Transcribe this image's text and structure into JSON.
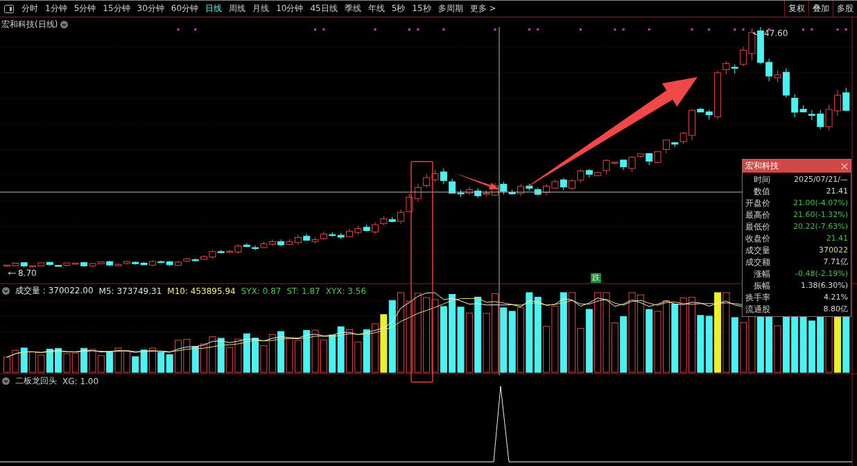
{
  "toolbar": {
    "periods": [
      {
        "label": "分时",
        "selected": false
      },
      {
        "label": "1分钟",
        "selected": false
      },
      {
        "label": "5分钟",
        "selected": false
      },
      {
        "label": "15分钟",
        "selected": false
      },
      {
        "label": "30分钟",
        "selected": false
      },
      {
        "label": "60分钟",
        "selected": false
      },
      {
        "label": "日线",
        "selected": true
      },
      {
        "label": "周线",
        "selected": false
      },
      {
        "label": "月线",
        "selected": false
      },
      {
        "label": "10分钟",
        "selected": false
      },
      {
        "label": "45日线",
        "selected": false
      },
      {
        "label": "季线",
        "selected": false
      },
      {
        "label": "年线",
        "selected": false
      },
      {
        "label": "5秒",
        "selected": false
      },
      {
        "label": "15秒",
        "selected": false
      },
      {
        "label": "多周期",
        "selected": false
      },
      {
        "label": "更多 >",
        "selected": false
      }
    ],
    "buttons": [
      "复权",
      "叠加",
      "多股"
    ]
  },
  "main_chart": {
    "title": "宏和科技(日线)",
    "high_label": "47.60",
    "low_label": "8.70",
    "badge": "跌"
  },
  "info_panel": {
    "title": "宏和科技",
    "rows": [
      {
        "label": "时间",
        "value": "2025/07/21/—",
        "color": "#d8d8d8"
      },
      {
        "label": "数值",
        "value": "21.41",
        "color": "#d8d8d8"
      },
      {
        "label": "开盘价",
        "value": "21.00(-4.07%)",
        "color": "#40c040"
      },
      {
        "label": "最高价",
        "value": "21.60(-1.32%)",
        "color": "#40c040"
      },
      {
        "label": "最低价",
        "value": "20.22(-7.63%)",
        "color": "#40c040"
      },
      {
        "label": "收盘价",
        "value": "21.41",
        "color": "#40c040"
      },
      {
        "label": "成交量",
        "value": "370022",
        "color": "#d8d8a0"
      },
      {
        "label": "成交额",
        "value": "7.71亿",
        "color": "#d8d8d8"
      },
      {
        "label": "涨幅",
        "value": "-0.48(-2.19%)",
        "color": "#40c040"
      },
      {
        "label": "振幅",
        "value": "1.38(6.30%)",
        "color": "#d8d8d8"
      },
      {
        "label": "换手率",
        "value": "4.21%",
        "color": "#d8d8d8"
      },
      {
        "label": "流通股",
        "value": "8.80亿",
        "color": "#d8d8d8"
      }
    ]
  },
  "volume_pane": {
    "legend": [
      {
        "text": "成交量 : 370022.00",
        "color": "#e0e0e0"
      },
      {
        "text": "M5: 373749.31",
        "color": "#e0e0e0"
      },
      {
        "text": "M10: 453895.94",
        "color": "#f0f080"
      },
      {
        "text": "SYX: 0.87",
        "color": "#50c050"
      },
      {
        "text": "ST: 1.87",
        "color": "#50c050"
      },
      {
        "text": "XYX: 3.56",
        "color": "#50c050"
      }
    ]
  },
  "indicator_pane": {
    "name": "二板龙回头",
    "value": "XG: 1.00"
  }
}
